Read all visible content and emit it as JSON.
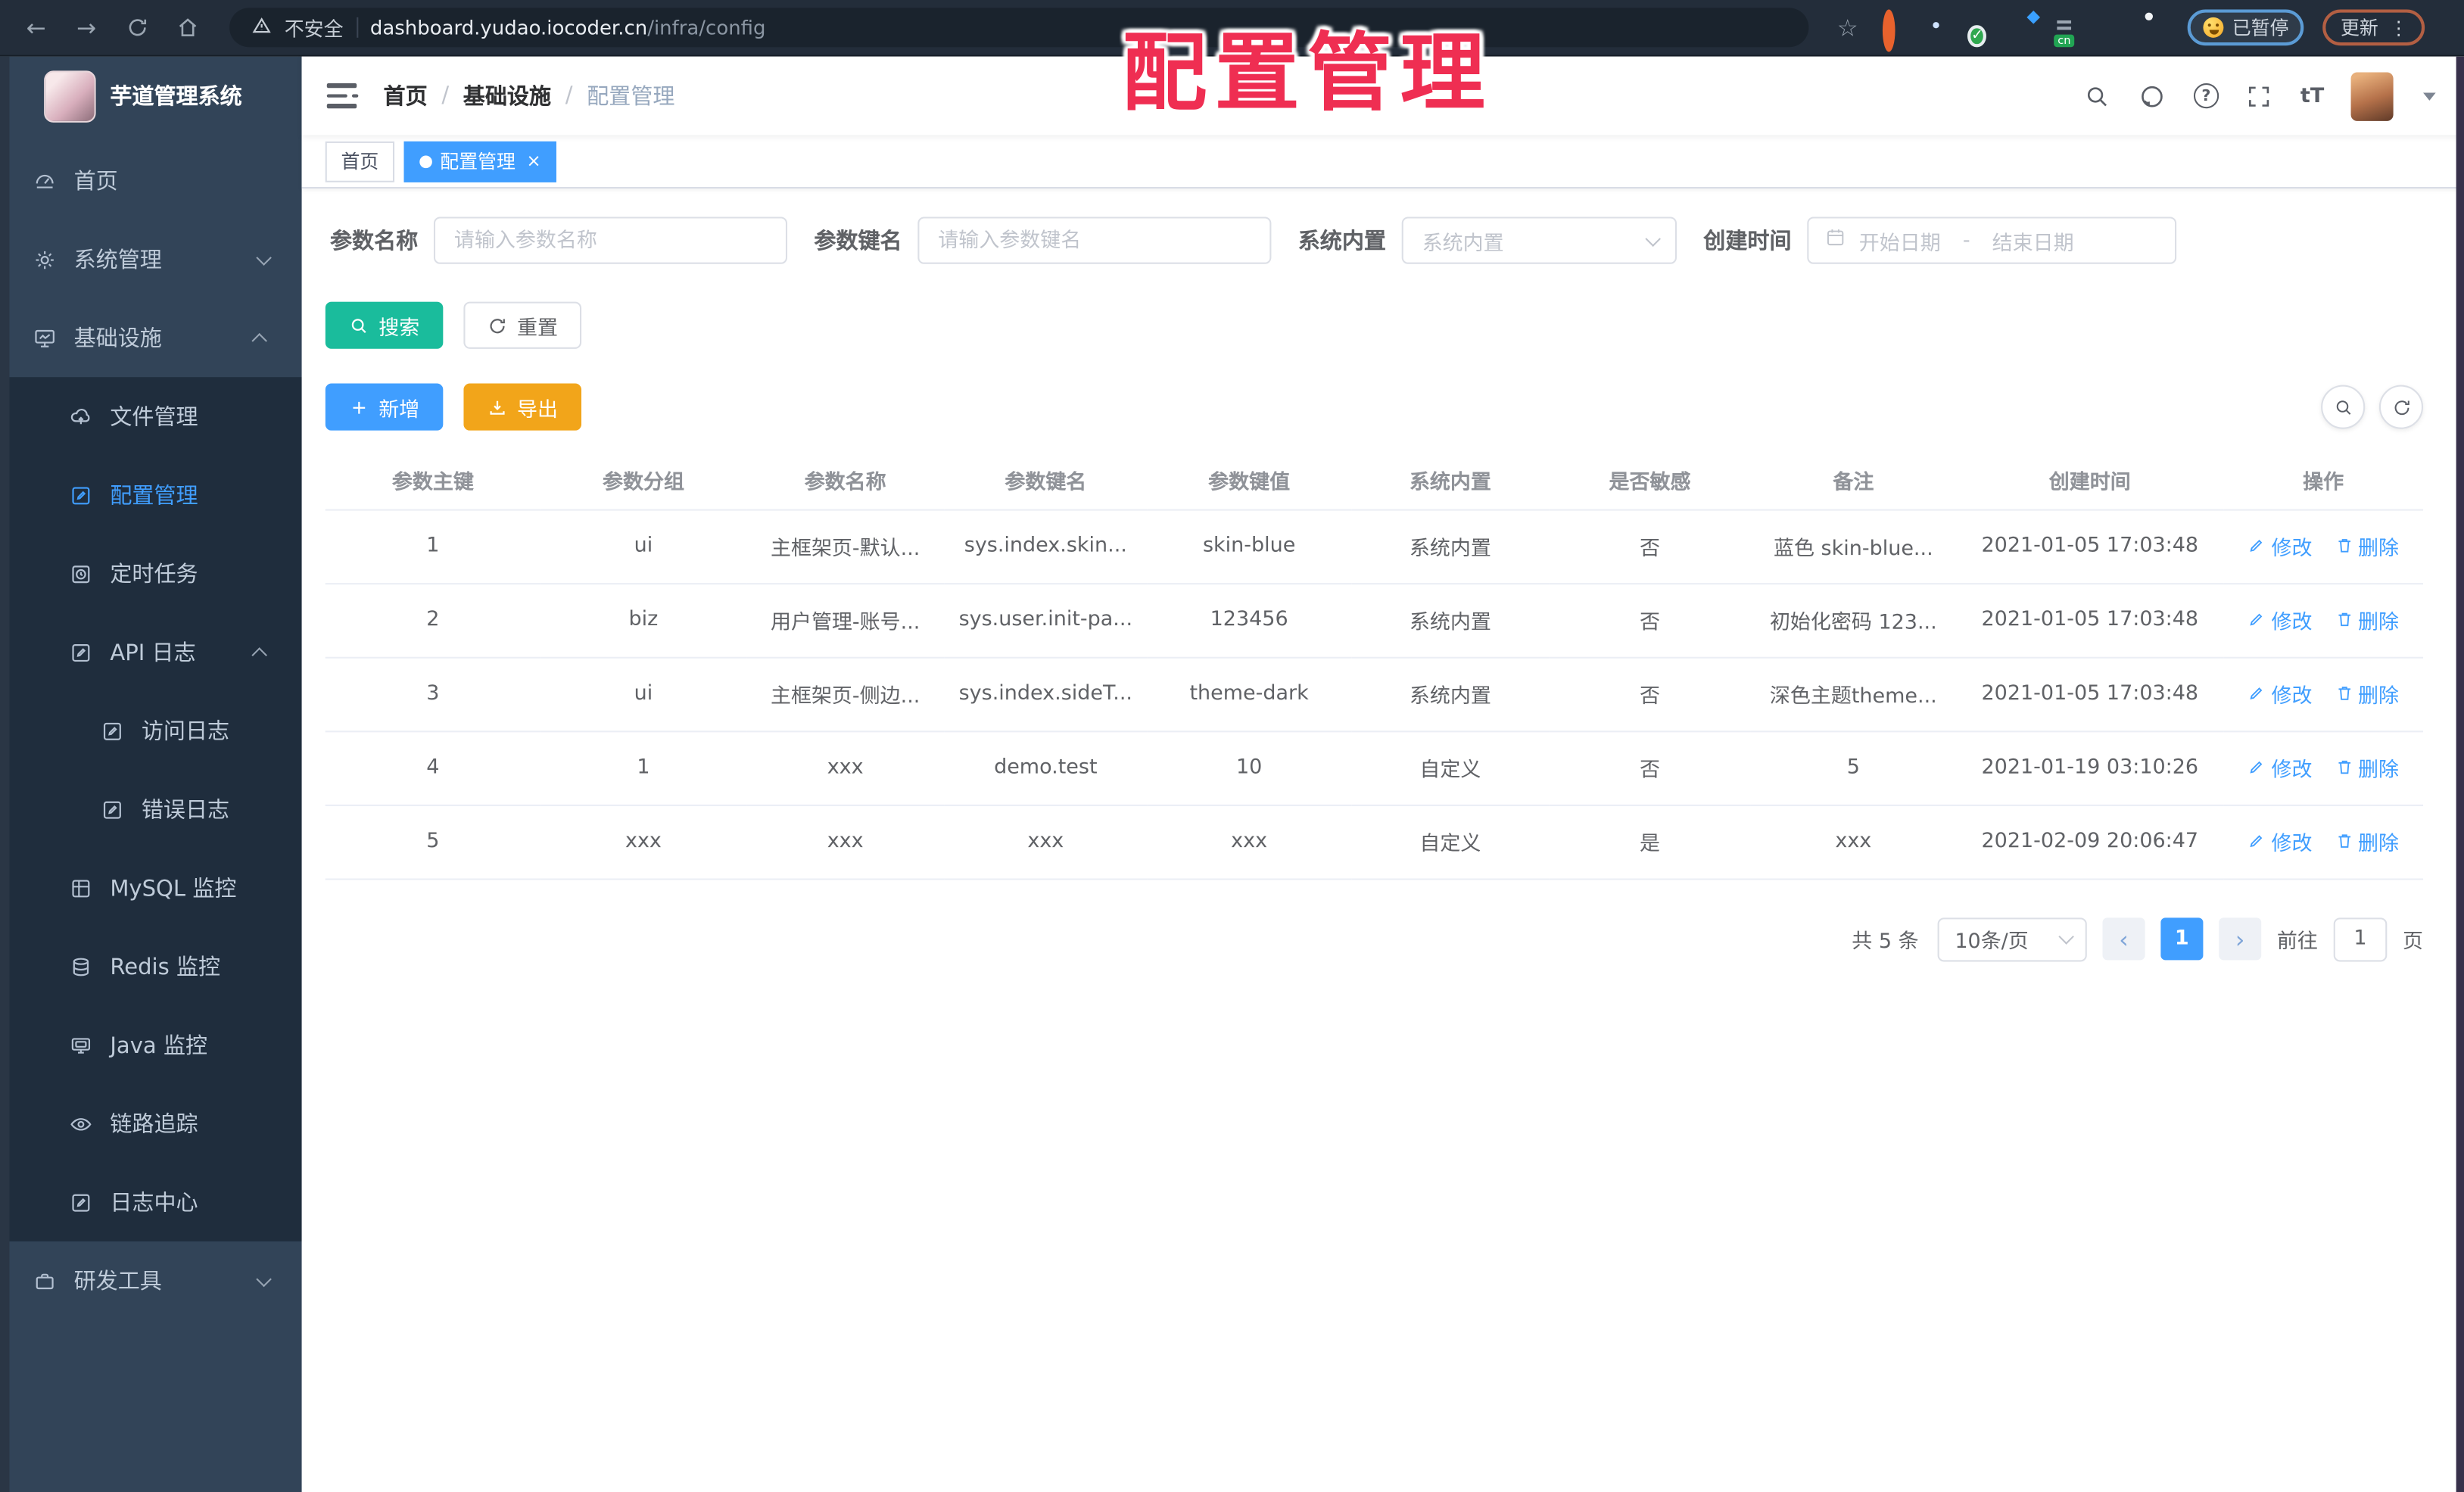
{
  "overlay": {
    "title": "配置管理",
    "color": "#ef2e52"
  },
  "browser": {
    "back_glyph": "←",
    "forward_glyph": "→",
    "insecure_label": "不安全",
    "url_host": "dashboard.yudao.iocoder.cn",
    "url_path": "/infra/config",
    "star_glyph": "☆",
    "extensions": [
      "orange-ring",
      "blue-pin",
      "green-check",
      "gray-grid-diamond",
      "cn-translate",
      "green-sprout",
      "puzzle"
    ],
    "cn_badge": "cn",
    "paused_label": "已暂停",
    "update_label": "更新",
    "menu_dots": "⋮",
    "check_glyph": "✓"
  },
  "sidebar": {
    "app_title": "芋道管理系统",
    "menu": [
      {
        "label": "首页",
        "icon": "gauge-icon"
      },
      {
        "label": "系统管理",
        "icon": "gear-icon",
        "chevron": "down"
      },
      {
        "label": "基础设施",
        "icon": "monitor-chart-icon",
        "chevron": "up"
      },
      {
        "label": "文件管理",
        "icon": "cloud-upload-icon"
      },
      {
        "label": "配置管理",
        "icon": "edit-square-icon",
        "active": true
      },
      {
        "label": "定时任务",
        "icon": "clock-square-icon"
      },
      {
        "label": "API 日志",
        "icon": "edit-square-icon",
        "chevron": "up"
      },
      {
        "label": "访问日志",
        "icon": "edit-square-icon"
      },
      {
        "label": "错误日志",
        "icon": "edit-square-icon"
      },
      {
        "label": "MySQL 监控",
        "icon": "table-grid-icon"
      },
      {
        "label": "Redis 监控",
        "icon": "database-icon"
      },
      {
        "label": "Java 监控",
        "icon": "screen-icon"
      },
      {
        "label": "链路追踪",
        "icon": "eye-icon"
      },
      {
        "label": "日志中心",
        "icon": "edit-square-icon"
      },
      {
        "label": "研发工具",
        "icon": "briefcase-icon",
        "chevron": "down"
      }
    ],
    "colors": {
      "bg": "#324458",
      "submenu_bg": "#1f2d3d",
      "text": "#bfcbd9",
      "active": "#409eff"
    }
  },
  "navbar": {
    "breadcrumb": [
      "首页",
      "基础设施",
      "配置管理"
    ],
    "separator": "/",
    "help_glyph": "?",
    "fontsize_glyph": "tT"
  },
  "tabs": {
    "items": [
      {
        "label": "首页",
        "active": false
      },
      {
        "label": "配置管理",
        "active": true
      }
    ],
    "close_glyph": "×",
    "active_color": "#409eff"
  },
  "filters": {
    "name_label": "参数名称",
    "name_placeholder": "请输入参数名称",
    "key_label": "参数键名",
    "key_placeholder": "请输入参数键名",
    "type_label": "系统内置",
    "type_placeholder": "系统内置",
    "date_label": "创建时间",
    "date_start": "开始日期",
    "date_separator": "-",
    "date_end": "结束日期",
    "search_label": "搜索",
    "reset_label": "重置",
    "add_label": "新增",
    "export_label": "导出",
    "colors": {
      "search": "#1abc9c",
      "add": "#409eff",
      "export": "#f2a51a"
    }
  },
  "table": {
    "columns": [
      "参数主键",
      "参数分组",
      "参数名称",
      "参数键名",
      "参数键值",
      "系统内置",
      "是否敏感",
      "备注",
      "创建时间",
      "操作"
    ],
    "rows": [
      {
        "id": "1",
        "group": "ui",
        "name": "主框架页-默认...",
        "key": "sys.index.skin...",
        "value": "skin-blue",
        "builtin": "系统内置",
        "sensitive": "否",
        "remark": "蓝色 skin-blue...",
        "created": "2021-01-05 17:03:48"
      },
      {
        "id": "2",
        "group": "biz",
        "name": "用户管理-账号...",
        "key": "sys.user.init-pa...",
        "value": "123456",
        "builtin": "系统内置",
        "sensitive": "否",
        "remark": "初始化密码 123...",
        "created": "2021-01-05 17:03:48"
      },
      {
        "id": "3",
        "group": "ui",
        "name": "主框架页-侧边...",
        "key": "sys.index.sideT...",
        "value": "theme-dark",
        "builtin": "系统内置",
        "sensitive": "否",
        "remark": "深色主题theme...",
        "created": "2021-01-05 17:03:48"
      },
      {
        "id": "4",
        "group": "1",
        "name": "xxx",
        "key": "demo.test",
        "value": "10",
        "builtin": "自定义",
        "sensitive": "否",
        "remark": "5",
        "created": "2021-01-19 03:10:26"
      },
      {
        "id": "5",
        "group": "xxx",
        "name": "xxx",
        "key": "xxx",
        "value": "xxx",
        "builtin": "自定义",
        "sensitive": "是",
        "remark": "xxx",
        "created": "2021-02-09 20:06:47"
      }
    ],
    "edit_label": "修改",
    "delete_label": "删除"
  },
  "pagination": {
    "total": "共 5 条",
    "page_size": "10条/页",
    "prev_glyph": "‹",
    "next_glyph": "›",
    "current": "1",
    "goto_label": "前往",
    "goto_value": "1",
    "unit_label": "页"
  }
}
